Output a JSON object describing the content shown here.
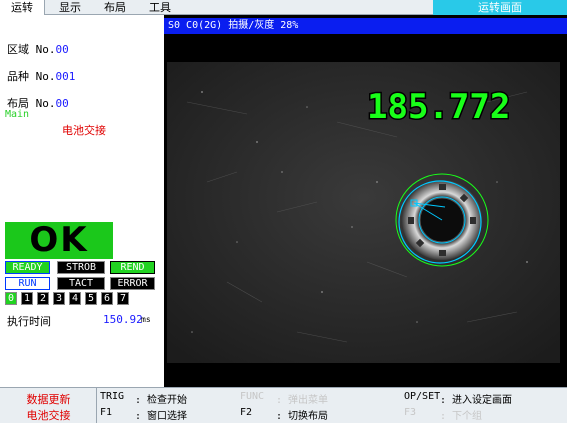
{
  "menu": {
    "items": [
      "运转",
      "显示",
      "布局",
      "工具"
    ],
    "active_index": 0,
    "screen_title": "运转画面"
  },
  "info": {
    "area_label": "区域 No.",
    "area_value": "00",
    "product_label": "品种 No.",
    "product_value": "001",
    "layout_label": "布局 No.",
    "layout_value": "00",
    "mode": "Main",
    "message": "电池交接"
  },
  "result": {
    "judgement": "OK",
    "statuses": {
      "ready": "READY",
      "strob": "STROB",
      "rend": "REND",
      "run": "RUN",
      "tact": "TACT",
      "error": "ERROR"
    },
    "indices": [
      "0",
      "1",
      "2",
      "3",
      "4",
      "5",
      "6",
      "7"
    ],
    "active_index": 0,
    "time_label": "执行时间",
    "time_value": "150.92",
    "time_unit": "ms"
  },
  "image": {
    "header": "S0 C0(2G) 拍摄/灰度 28%",
    "measurement": "185.772",
    "colors": {
      "measurement": "#19ff19",
      "circle": "#19ff19",
      "marker": "#00c8ff"
    }
  },
  "footer": {
    "left_top": "数据更新",
    "left_bottom": "电池交接",
    "trig_key": "TRIG",
    "trig_desc": ": 检查开始",
    "f1_key": "F1",
    "f1_desc": ": 窗口选择",
    "func_key": "FUNC",
    "func_desc": ": 弹出菜单",
    "f2_key": "F2",
    "f2_desc": ": 切换布局",
    "opset_key": "OP/SET",
    "opset_desc": ": 进入设定画面",
    "f3_key": "F3",
    "f3_desc": ": 下个组"
  },
  "colors": {
    "ok_green": "#1bc81b",
    "header_blue": "#0a1ef0",
    "title_cyan": "#29c9e8",
    "alert_red": "#e00000"
  }
}
